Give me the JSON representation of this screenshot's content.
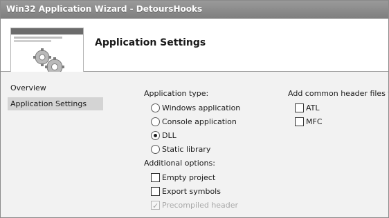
{
  "window": {
    "title": "Win32 Application Wizard - DetoursHooks"
  },
  "header": {
    "heading": "Application Settings",
    "banner_icon": "gears-icon"
  },
  "nav": {
    "items": [
      {
        "label": "Overview",
        "active": false
      },
      {
        "label": "Application Settings",
        "active": true
      }
    ]
  },
  "application_type": {
    "label": "Application type:",
    "options": [
      {
        "label": "Windows application",
        "selected": false
      },
      {
        "label": "Console application",
        "selected": false
      },
      {
        "label": "DLL",
        "selected": true
      },
      {
        "label": "Static library",
        "selected": false
      }
    ]
  },
  "additional_options": {
    "label": "Additional options:",
    "options": [
      {
        "label": "Empty project",
        "checked": false,
        "enabled": true
      },
      {
        "label": "Export symbols",
        "checked": false,
        "enabled": true
      },
      {
        "label": "Precompiled header",
        "checked": true,
        "enabled": false
      }
    ]
  },
  "common_headers": {
    "label": "Add common header files for:",
    "options": [
      {
        "label": "ATL",
        "checked": false
      },
      {
        "label": "MFC",
        "checked": false
      }
    ]
  },
  "colors": {
    "title_bar": "#8a8a8a",
    "header_bg": "#ffffff",
    "body_bg": "#f2f2f2",
    "selected_nav": "#d4d4d4"
  }
}
